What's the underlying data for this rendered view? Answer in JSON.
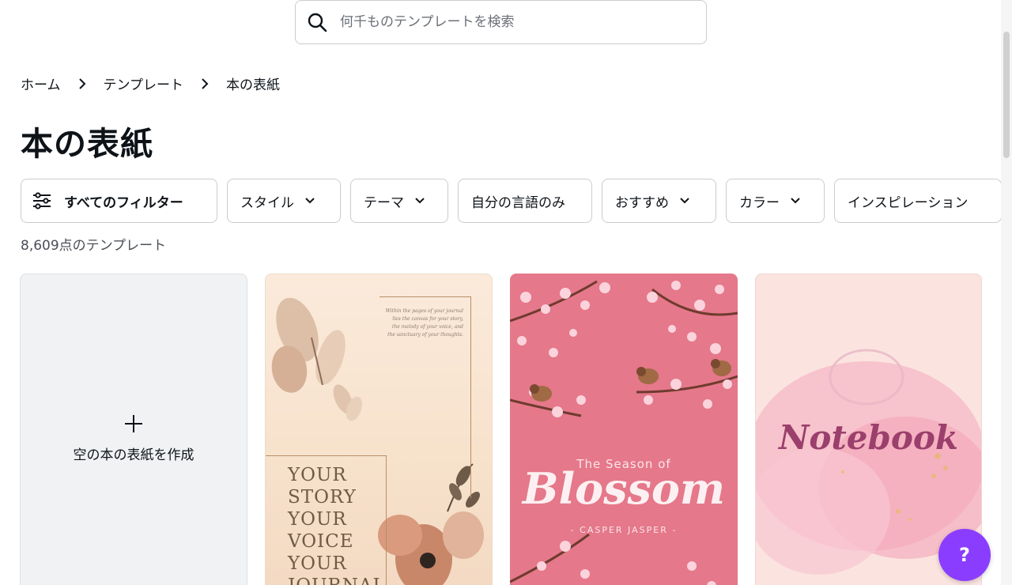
{
  "search": {
    "placeholder": "何千ものテンプレートを検索"
  },
  "breadcrumb": {
    "items": [
      "ホーム",
      "テンプレート",
      "本の表紙"
    ]
  },
  "page_title": "本の表紙",
  "filters": {
    "all": "すべてのフィルター",
    "chips": [
      "スタイル",
      "テーマ",
      "自分の言語のみ",
      "おすすめ",
      "カラー",
      "インスピレーション"
    ]
  },
  "result_count": "8,609点のテンプレート",
  "create_card": {
    "icon": "plus-icon",
    "label": "空の本の表紙を作成"
  },
  "templates": [
    {
      "quote": "Within the pages of your journal lies the canvas for your story, the melody of your voice, and the sanctuary of your thoughts.",
      "lines": [
        "YOUR",
        "STORY",
        "YOUR",
        "VOICE",
        "YOUR",
        "JOURNAL"
      ]
    },
    {
      "subtitle": "The Season of",
      "title": "Blossom",
      "author": "- CASPER JASPER -"
    },
    {
      "title": "Notebook"
    }
  ],
  "help": {
    "label": "?"
  },
  "colors": {
    "accent": "#8b3dff",
    "blossom_bg": "#e5788a",
    "notebook_text": "#9b3f6c"
  }
}
